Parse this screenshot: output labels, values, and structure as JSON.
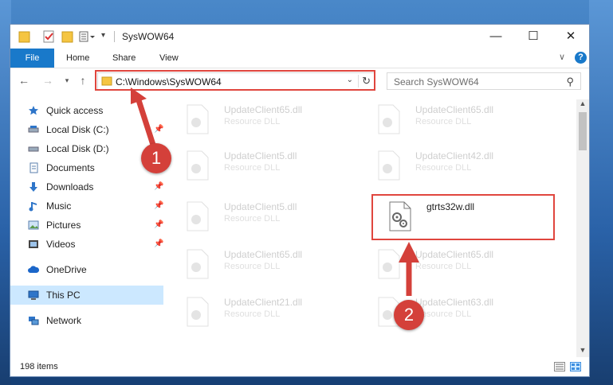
{
  "window": {
    "title": "SysWOW64",
    "controls": {
      "minimize": "—",
      "maximize": "☐",
      "close": "✕"
    }
  },
  "ribbon": {
    "tabs": [
      "File",
      "Home",
      "Share",
      "View"
    ],
    "collapse": "∨",
    "help": "?"
  },
  "navigation": {
    "address": "C:\\Windows\\SysWOW64",
    "search_placeholder": "Search SysWOW64"
  },
  "sidebar": {
    "items": [
      {
        "label": "Quick access",
        "icon": "star-icon"
      },
      {
        "label": "Local Disk (C:)",
        "icon": "drive-icon"
      },
      {
        "label": "Local Disk (D:)",
        "icon": "drive-icon"
      },
      {
        "label": "Documents",
        "icon": "documents-icon"
      },
      {
        "label": "Downloads",
        "icon": "download-icon"
      },
      {
        "label": "Music",
        "icon": "music-icon"
      },
      {
        "label": "Pictures",
        "icon": "pictures-icon"
      },
      {
        "label": "Videos",
        "icon": "videos-icon"
      },
      {
        "label": "OneDrive",
        "icon": "cloud-icon"
      },
      {
        "label": "This PC",
        "icon": "computer-icon"
      },
      {
        "label": "Network",
        "icon": "network-icon"
      }
    ]
  },
  "files": [
    {
      "name": "UpdateClient65.dll",
      "type": "Resource DLL"
    },
    {
      "name": "UpdateClient65.dll",
      "type": "Resource DLL"
    },
    {
      "name": "UpdateClient5.dll",
      "type": "Resource DLL"
    },
    {
      "name": "UpdateClient42.dll",
      "type": "Resource DLL"
    },
    {
      "name": "UpdateClient5.dll",
      "type": "Resource DLL"
    },
    {
      "name": "gtrts32w.dll",
      "type": ""
    },
    {
      "name": "UpdateClient65.dll",
      "type": "Resource DLL"
    },
    {
      "name": "UpdateClient65.dll",
      "type": "Resource DLL"
    },
    {
      "name": "UpdateClient21.dll",
      "type": "Resource DLL"
    },
    {
      "name": "UpdateClient63.dll",
      "type": "Resource DLL"
    }
  ],
  "status": {
    "items": "198 items"
  },
  "annotations": {
    "step1": "1",
    "step2": "2"
  },
  "colors": {
    "accent": "#1979ca",
    "highlight": "#e0463e",
    "selected": "#cce8ff"
  }
}
